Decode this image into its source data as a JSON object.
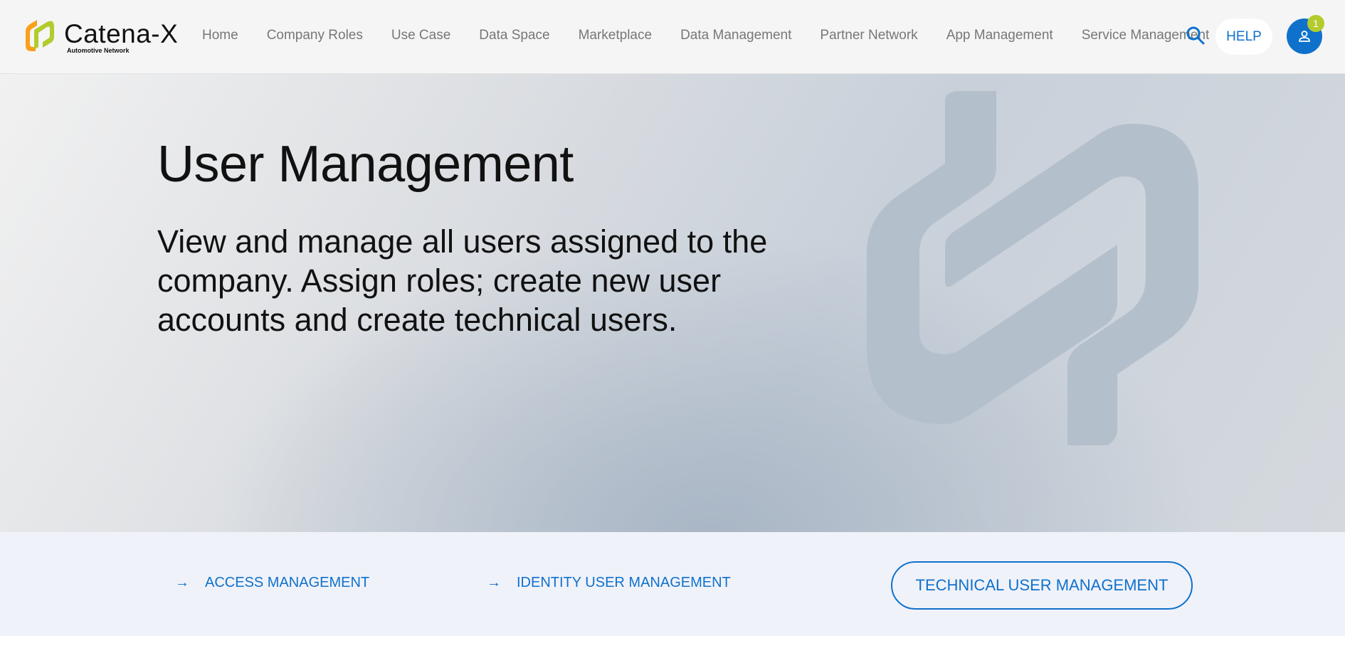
{
  "brand": {
    "name": "Catena-X",
    "tagline": "Automotive Network",
    "colors": {
      "orange": "#f9a01b",
      "green": "#b3cb2d",
      "blue": "#0f71cb"
    }
  },
  "nav": {
    "items": [
      {
        "label": "Home"
      },
      {
        "label": "Company Roles"
      },
      {
        "label": "Use Case"
      },
      {
        "label": "Data Space"
      },
      {
        "label": "Marketplace"
      },
      {
        "label": "Data Management"
      },
      {
        "label": "Partner Network"
      },
      {
        "label": "App Management"
      },
      {
        "label": "Service Management"
      }
    ],
    "search_icon": "search-icon",
    "help_label": "HELP",
    "user_icon": "user-icon",
    "notification_count": "1"
  },
  "hero": {
    "title": "User Management",
    "description": "View and manage all users assigned to the company. Assign roles; create new user accounts and create technical users."
  },
  "links": {
    "arrow": "→",
    "access_management": "ACCESS MANAGEMENT",
    "identity_user_management": "IDENTITY USER MANAGEMENT",
    "technical_user_management": "TECHNICAL USER MANAGEMENT"
  }
}
